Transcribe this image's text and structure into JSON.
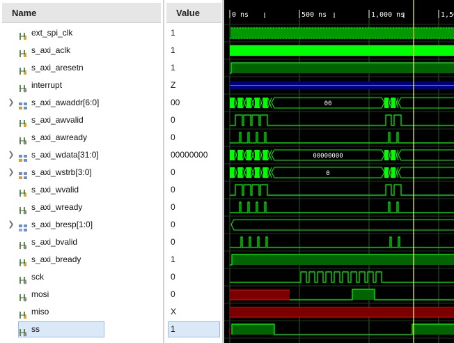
{
  "headers": {
    "name": "Name",
    "value": "Value"
  },
  "timeline": {
    "ticks": [
      "0 ns",
      "500 ns",
      "1,000 ns",
      "1,50"
    ]
  },
  "signals": [
    {
      "name": "ext_spi_clk",
      "value": "1",
      "icon": "wire-icon",
      "bus": false
    },
    {
      "name": "s_axi_aclk",
      "value": "1",
      "icon": "wire-icon",
      "bus": false
    },
    {
      "name": "s_axi_aresetn",
      "value": "1",
      "icon": "wire-icon",
      "bus": false
    },
    {
      "name": "interrupt",
      "value": "Z",
      "icon": "output-wire-icon",
      "bus": false
    },
    {
      "name": "s_axi_awaddr[6:0]",
      "value": "00",
      "icon": "bus-icon",
      "bus": true
    },
    {
      "name": "s_axi_awvalid",
      "value": "0",
      "icon": "wire-icon",
      "bus": false
    },
    {
      "name": "s_axi_awready",
      "value": "0",
      "icon": "output-wire-icon",
      "bus": false
    },
    {
      "name": "s_axi_wdata[31:0]",
      "value": "00000000",
      "icon": "bus-icon",
      "bus": true
    },
    {
      "name": "s_axi_wstrb[3:0]",
      "value": "0",
      "icon": "bus-icon",
      "bus": true
    },
    {
      "name": "s_axi_wvalid",
      "value": "0",
      "icon": "wire-icon",
      "bus": false
    },
    {
      "name": "s_axi_wready",
      "value": "0",
      "icon": "output-wire-icon",
      "bus": false
    },
    {
      "name": "s_axi_bresp[1:0]",
      "value": "0",
      "icon": "output-bus-icon",
      "bus": true
    },
    {
      "name": "s_axi_bvalid",
      "value": "0",
      "icon": "output-wire-icon",
      "bus": false
    },
    {
      "name": "s_axi_bready",
      "value": "1",
      "icon": "wire-icon",
      "bus": false
    },
    {
      "name": "sck",
      "value": "0",
      "icon": "output-wire-icon",
      "bus": false
    },
    {
      "name": "mosi",
      "value": "0",
      "icon": "output-wire-icon",
      "bus": false
    },
    {
      "name": "miso",
      "value": "X",
      "icon": "wire-icon",
      "bus": false
    },
    {
      "name": "ss",
      "value": "1",
      "icon": "output-wire-icon",
      "bus": false,
      "selected": true
    }
  ],
  "bus_labels": {
    "s_axi_awaddr": "00",
    "s_axi_wdata": "00000000",
    "s_axi_wstrb": "0"
  },
  "colors": {
    "wave_green": "#00ff00",
    "wave_fill": "#006400",
    "high_z_blue": "#000080",
    "unknown_red": "#ff0000",
    "cursor_yellow": "#ffff66",
    "grid": "#2e5a2e"
  }
}
